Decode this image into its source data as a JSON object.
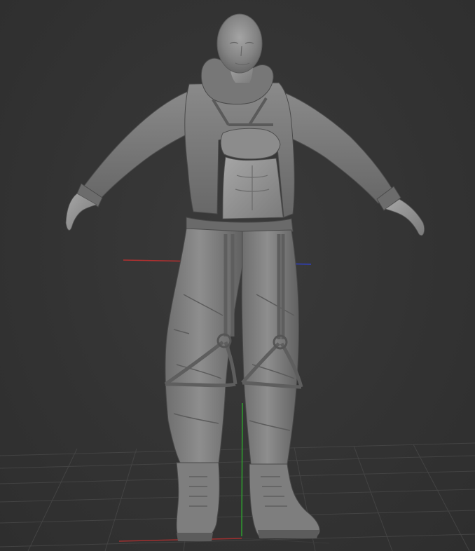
{
  "viewport": {
    "background": "#333333",
    "grid_color": "#4a4a4a",
    "axis_x_color": "#b03030",
    "axis_y_color": "#30a030",
    "axis_z_color": "#3040c0",
    "model_color": "#8a8a8a",
    "model_shade": "#5e5e5e",
    "model_highlight": "#a8a8a8"
  },
  "model": {
    "description_icon": "character-model-icon"
  }
}
